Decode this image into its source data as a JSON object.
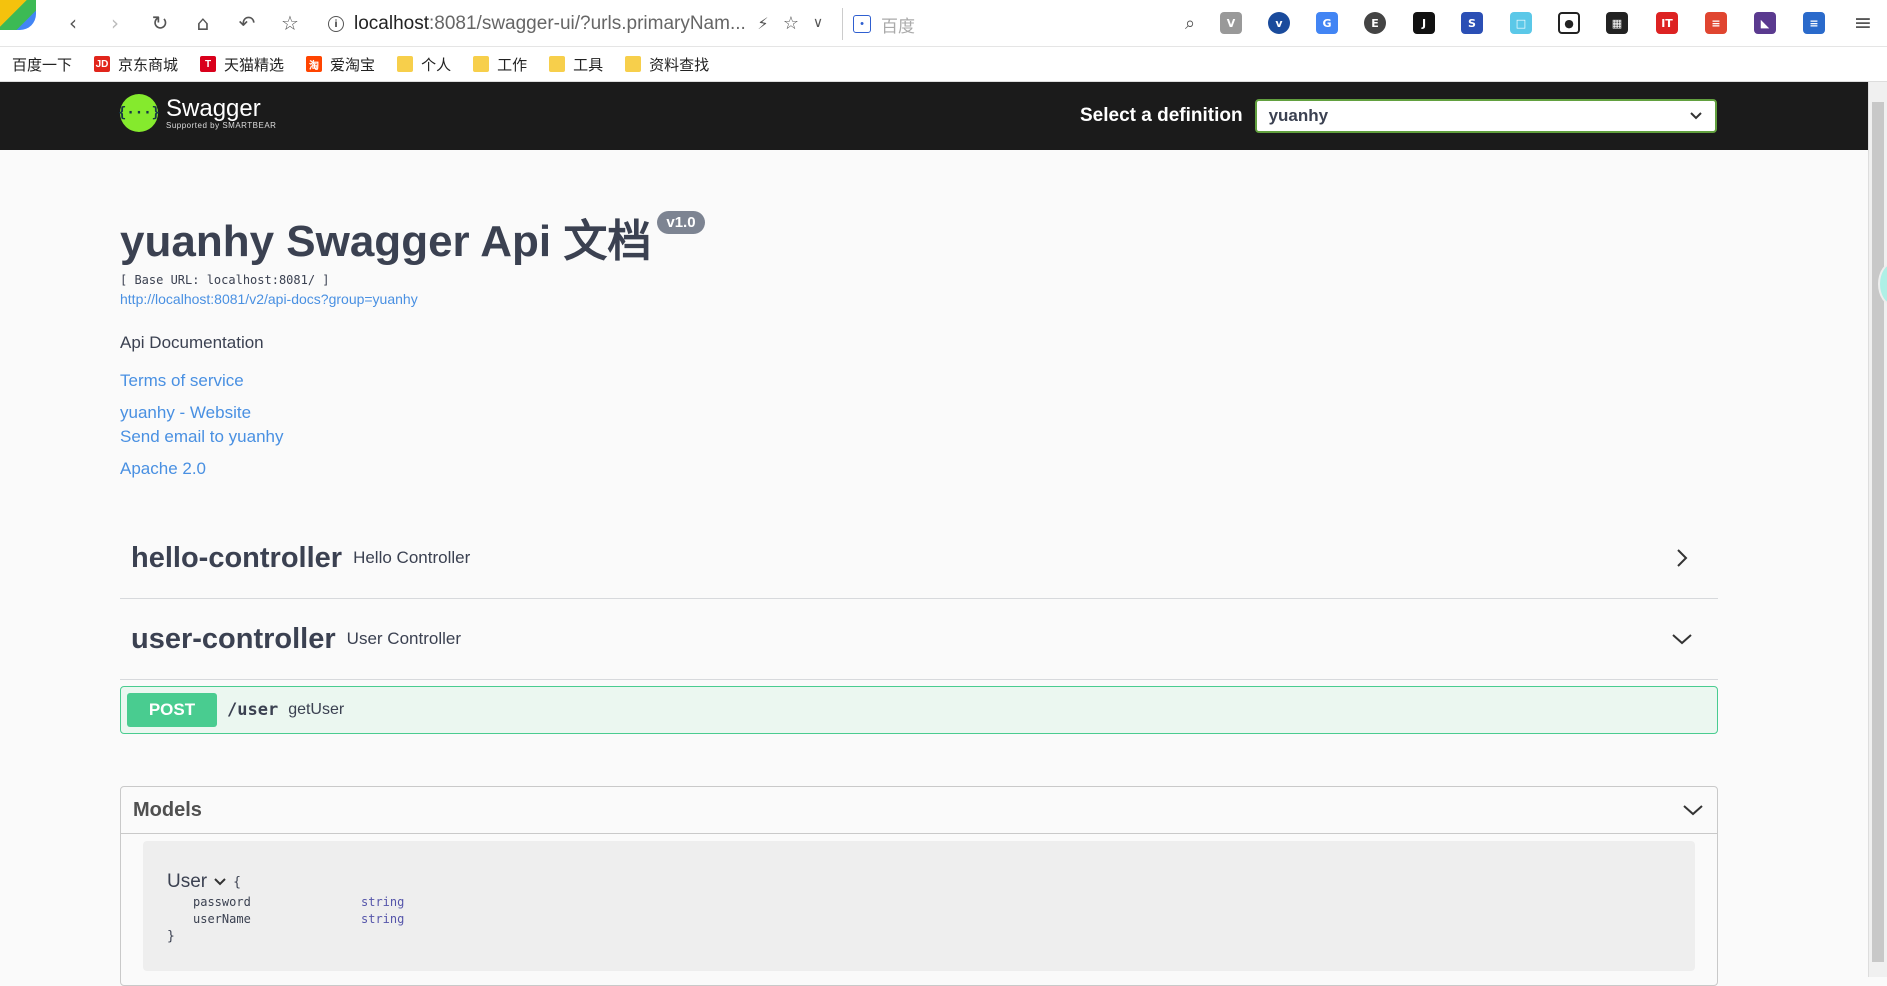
{
  "browser": {
    "url_host": "localhost",
    "url_rest": ":8081/swagger-ui/?urls.primaryNam...",
    "search_placeholder": "百度",
    "bookmarks": [
      {
        "label": "百度一下",
        "icon": "none"
      },
      {
        "label": "京东商城",
        "icon": "jd-icon"
      },
      {
        "label": "天猫精选",
        "icon": "tmall-icon"
      },
      {
        "label": "爱淘宝",
        "icon": "taobao-icon"
      },
      {
        "label": "个人",
        "icon": "folder-icon"
      },
      {
        "label": "工作",
        "icon": "folder-icon"
      },
      {
        "label": "工具",
        "icon": "folder-icon"
      },
      {
        "label": "资料查找",
        "icon": "folder-icon"
      }
    ]
  },
  "topbar": {
    "logo_text": "Swagger",
    "logo_sub": "Supported by SMARTBEAR",
    "logo_glyph": "{···}",
    "select_label": "Select a definition",
    "selected_definition": "yuanhy"
  },
  "info": {
    "title": "yuanhy Swagger Api 文档",
    "version": "v1.0",
    "base_url": "[ Base URL: localhost:8081/ ]",
    "spec_url": "http://localhost:8081/v2/api-docs?group=yuanhy",
    "description": "Api Documentation",
    "terms": "Terms of service",
    "website": "yuanhy - Website",
    "email": "Send email to yuanhy",
    "license": "Apache 2.0"
  },
  "tags": [
    {
      "name": "hello-controller",
      "description": "Hello Controller"
    },
    {
      "name": "user-controller",
      "description": "User Controller"
    }
  ],
  "operation": {
    "method": "POST",
    "path": "/user",
    "summary": "getUser"
  },
  "models": {
    "title": "Models",
    "model_name": "User",
    "open_brace": "{",
    "close_brace": "}",
    "properties": [
      {
        "name": "password",
        "type": "string"
      },
      {
        "name": "userName",
        "type": "string"
      }
    ]
  },
  "colors": {
    "post": "#49cc90",
    "link": "#4990e2",
    "topbar": "#1b1b1b",
    "logo": "#85ea2d"
  }
}
